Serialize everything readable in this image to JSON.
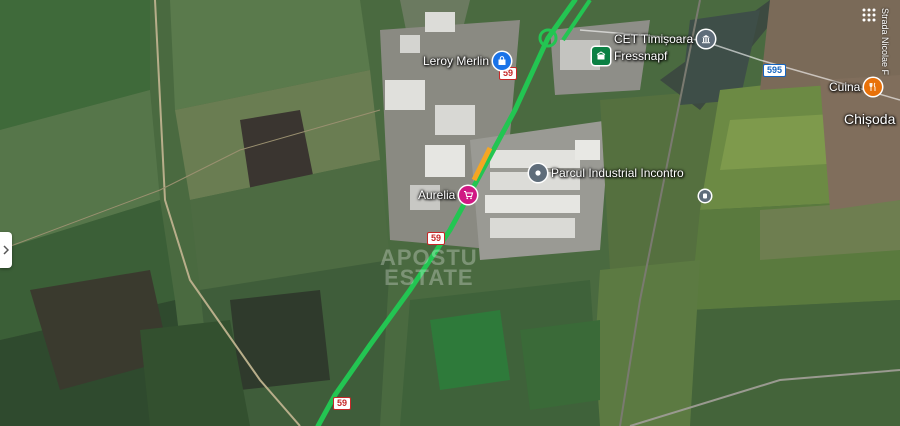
{
  "pois": [
    {
      "key": "leroy",
      "label": "Leroy Merlin",
      "icon": "shopping-bag-icon",
      "color": "#1a73e8"
    },
    {
      "key": "cet",
      "label": "CET Timișoara",
      "icon": "landmark-icon",
      "color": "#5f6d7a"
    },
    {
      "key": "fressnapf",
      "label": "Fressnapf",
      "icon": "pet-store-icon",
      "color": "#0b8043"
    },
    {
      "key": "parcul",
      "label": "Parcul Industrial Incontro",
      "icon": "place-dot-icon",
      "color": "#5f6d7a"
    },
    {
      "key": "aurelia",
      "label": "Aurelia",
      "icon": "shopping-cart-icon",
      "color": "#d01884"
    },
    {
      "key": "cuina",
      "label": "Cuina",
      "icon": "restaurant-icon",
      "color": "#e8710a"
    }
  ],
  "town": {
    "label": "Chișoda"
  },
  "street": {
    "label": "Strada Nicolae F"
  },
  "shields": {
    "r59a": "59",
    "r59b": "59",
    "r59c": "59",
    "r595": "595"
  },
  "watermark": {
    "line1": "APOSTU",
    "line2": "ESTATE"
  },
  "colors": {
    "traffic_green": "#23c552",
    "traffic_orange": "#f5a623"
  }
}
